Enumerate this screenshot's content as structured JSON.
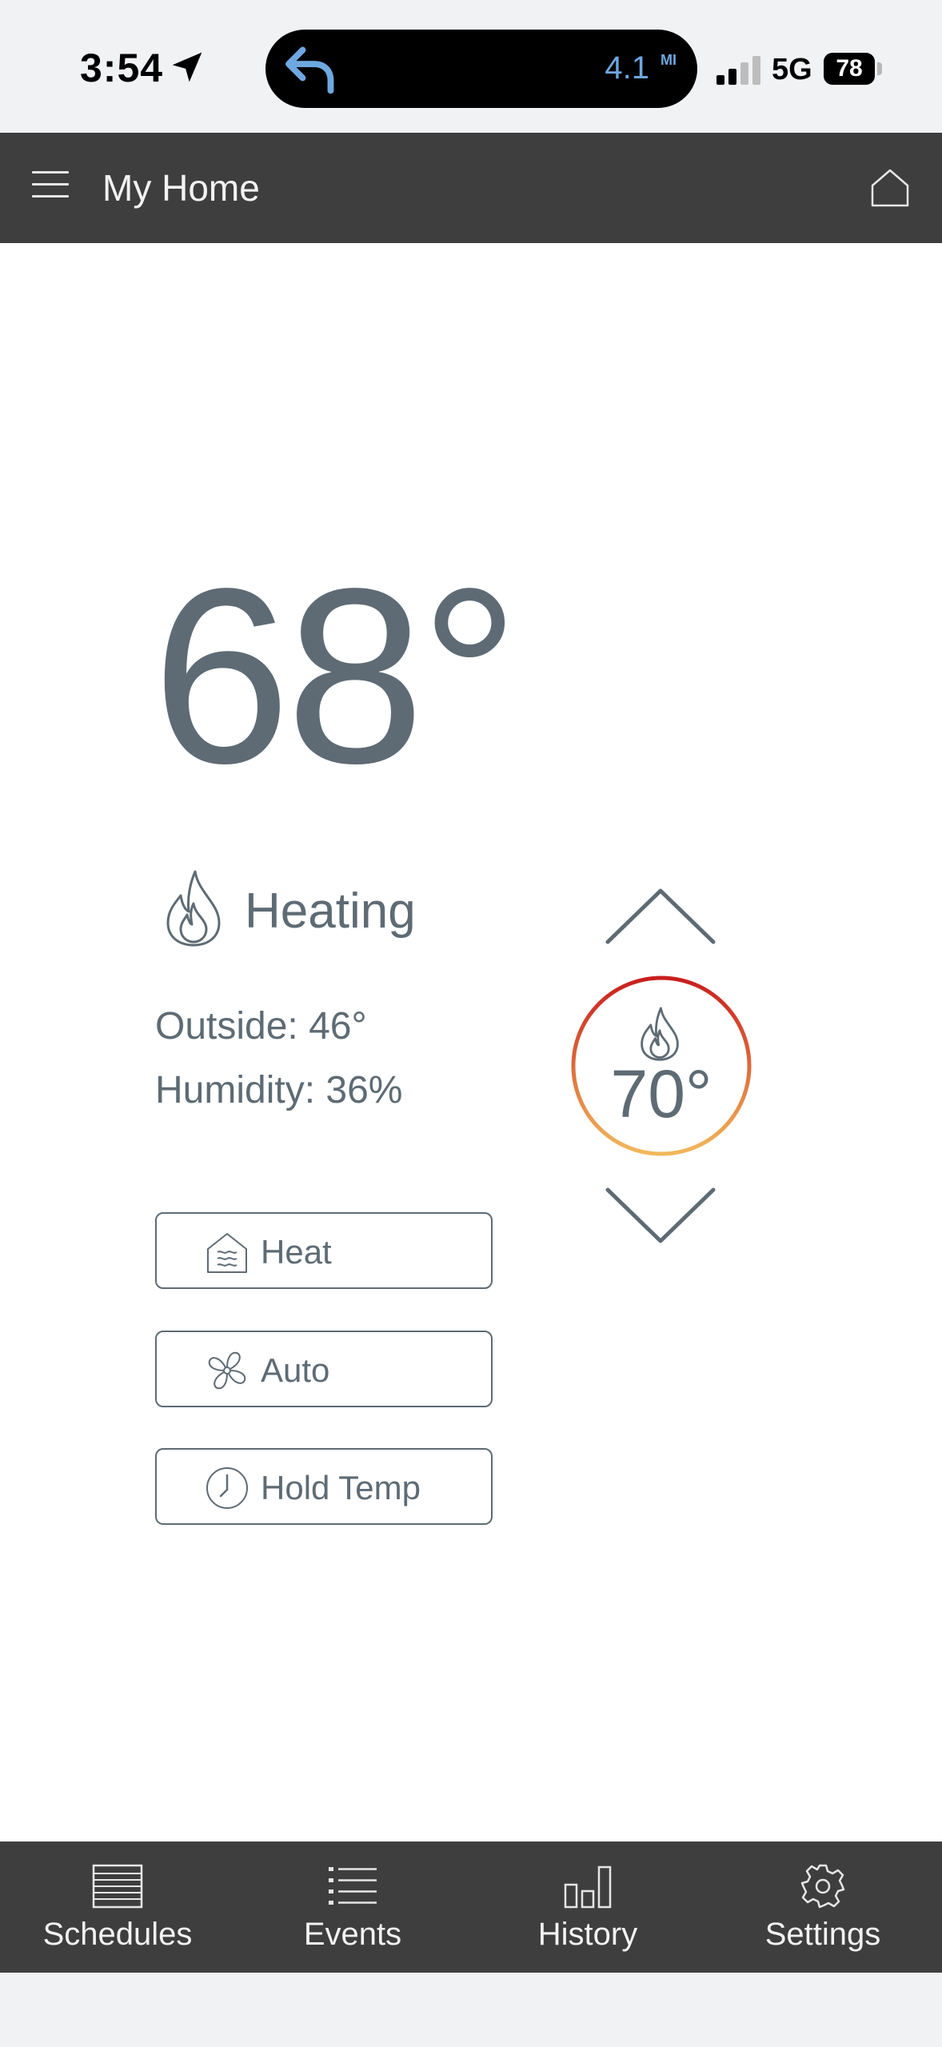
{
  "status_bar": {
    "time": "3:54",
    "island_distance": "4.1",
    "island_unit": "MI",
    "network": "5G",
    "battery": "78"
  },
  "header": {
    "title": "My Home"
  },
  "thermostat": {
    "current_temp": "68°",
    "mode": "Heating",
    "outside": "Outside: 46°",
    "humidity": "Humidity: 36%",
    "setpoint": "70°",
    "setpoint_ring_colors": [
      "#c81e1e",
      "#f2b85a"
    ],
    "buttons": {
      "heat": "Heat",
      "fan": "Auto",
      "hold": "Hold Temp"
    }
  },
  "tabs": [
    {
      "label": "Schedules",
      "icon": "schedules-icon"
    },
    {
      "label": "Events",
      "icon": "events-icon"
    },
    {
      "label": "History",
      "icon": "history-icon"
    },
    {
      "label": "Settings",
      "icon": "settings-icon"
    }
  ]
}
